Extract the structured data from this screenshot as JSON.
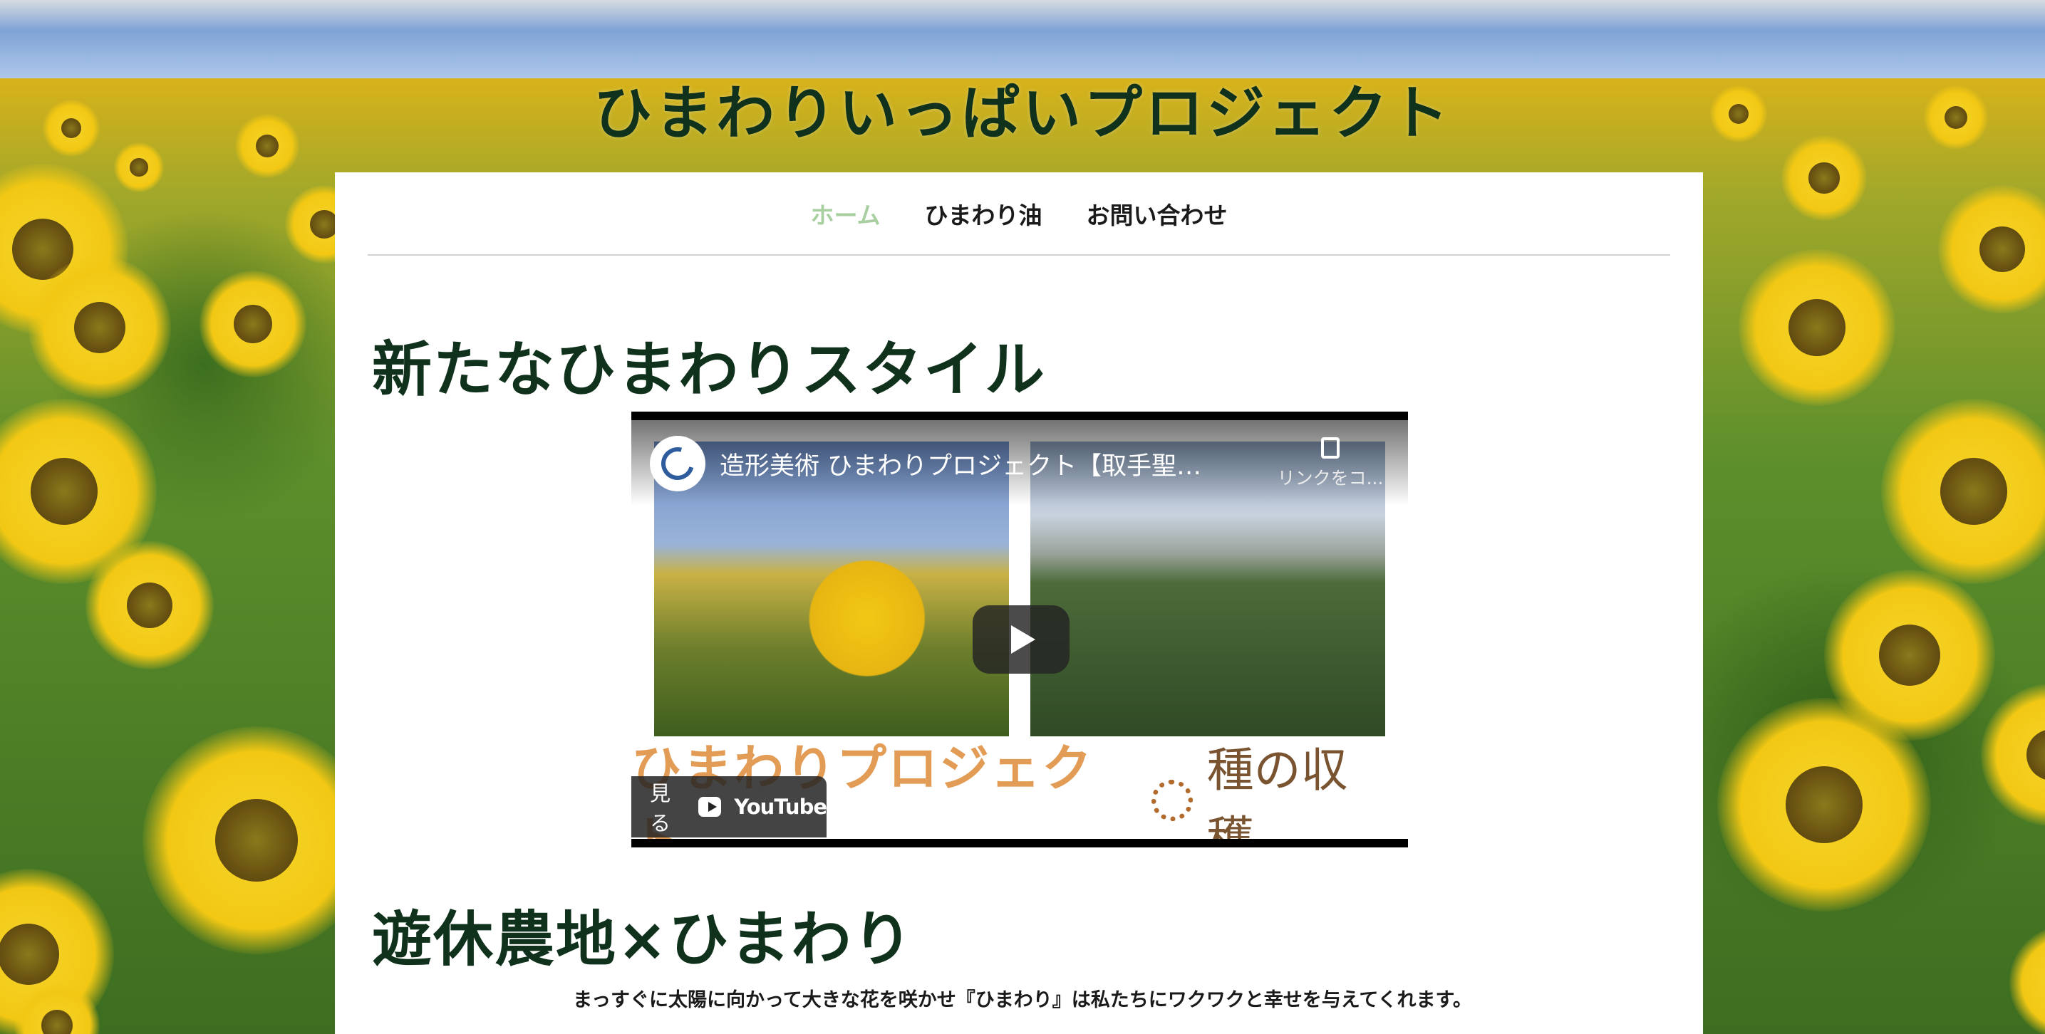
{
  "site": {
    "title": "ひまわりいっぱいプロジェクト"
  },
  "nav": {
    "items": [
      {
        "label": "ホーム",
        "active": true
      },
      {
        "label": "ひまわり油",
        "active": false
      },
      {
        "label": "お問い合わせ",
        "active": false
      }
    ]
  },
  "sections": {
    "first_heading": "新たなひまわりスタイル",
    "second_heading": "遊休農地×ひまわり",
    "lead_text": "まっすぐに太陽に向かって大きな花を咲かせ『ひまわり』は私たちにワクワクと幸せを与えてくれます。"
  },
  "video": {
    "title": "造形美術 ひまわりプロジェクト【取手聖徳...",
    "copy_link_label": "リンクをコ...",
    "banner_title": "ひまわりプロジェクト",
    "banner_subtitle": "種の収穫",
    "watch_label": "見る",
    "platform_label": "YouTube",
    "channel_icon": "channel-logo-icon",
    "play_icon": "play-icon",
    "copy_icon": "copy-icon"
  },
  "colors": {
    "title": "#10321c",
    "nav_active": "#a7cfa0",
    "card_bg": "#ffffff"
  }
}
